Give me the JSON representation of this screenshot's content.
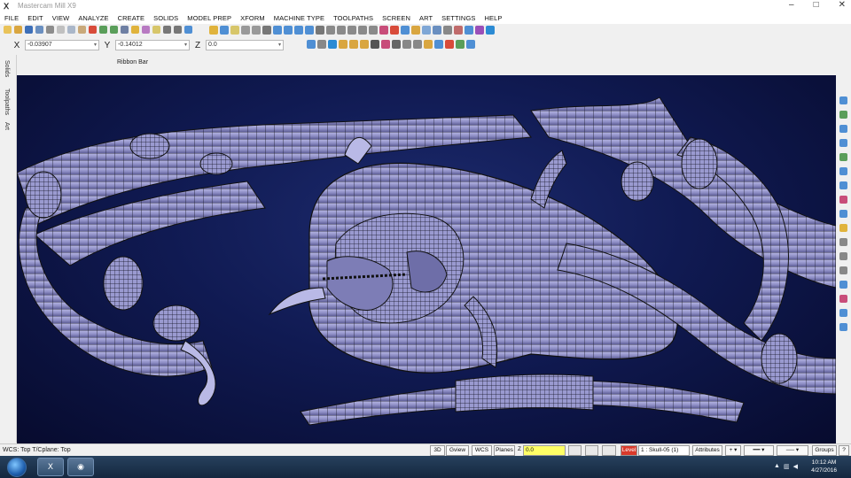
{
  "window": {
    "title": "Mastercam Mill X9",
    "icon": "mastercam-logo-icon"
  },
  "menu": [
    "FILE",
    "EDIT",
    "VIEW",
    "ANALYZE",
    "CREATE",
    "SOLIDS",
    "MODEL PREP",
    "XFORM",
    "MACHINE TYPE",
    "TOOLPATHS",
    "SCREEN",
    "ART",
    "SETTINGS",
    "HELP"
  ],
  "coords": {
    "x_label": "X",
    "x_value": "-0.03907",
    "y_label": "Y",
    "y_value": "-0.14012",
    "z_label": "Z",
    "z_value": "0.0"
  },
  "ribbon_bar_label": "Ribbon Bar",
  "left_tabs": [
    "Solids",
    "Toolpaths",
    "Art"
  ],
  "status": {
    "wcs_text": "WCS: Top  T/Cplane: Top",
    "btn_3d": "3D",
    "btn_gview": "Gview",
    "btn_wcs": "WCS",
    "btn_planes": "Planes",
    "z_label": "Z",
    "z_value": "0.0",
    "level_label": "Level",
    "level_value": "1 : Skull-05 (1)",
    "attributes_label": "Attributes",
    "groups_label": "Groups",
    "help_label": "?"
  },
  "taskbar": {
    "time": "10:12 AM",
    "date": "4/27/2016",
    "start_icon": "windows-start-orb-icon",
    "apps": [
      "mastercam-app-icon",
      "browser-app-icon"
    ]
  },
  "colors": {
    "viewport_bg": "#0d1547",
    "model_fill": "#8f8fc8",
    "level_accent": "#d93a2b",
    "z_field": "#ffff66"
  }
}
